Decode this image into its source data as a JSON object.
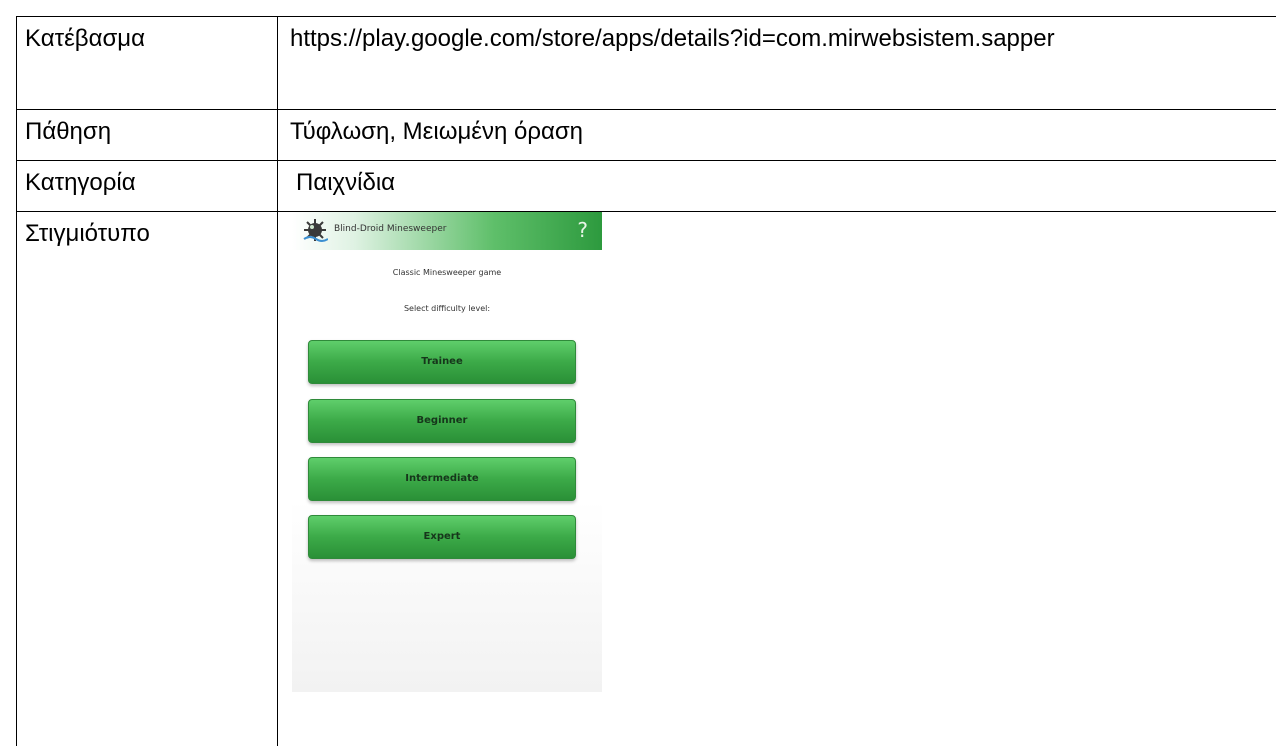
{
  "rows": {
    "download": {
      "label": "Κατέβασμα",
      "value": "https://play.google.com/store/apps/details?id=com.mirwebsistem.sapper"
    },
    "condition": {
      "label": "Πάθηση",
      "value": "Τύφλωση, Μειωμένη όραση"
    },
    "category": {
      "label": "Κατηγορία",
      "value": "Παιχνίδια"
    },
    "screenshot": {
      "label": "Στιγμιότυπο"
    }
  },
  "app": {
    "title": "Blind-Droid Minesweeper",
    "help": "?",
    "subtitle": "Classic Minesweeper game",
    "select_label": "Select difficulty level:",
    "levels": [
      "Trainee",
      "Beginner",
      "Intermediate",
      "Expert"
    ],
    "colors": {
      "accent": "#3caa48",
      "accent_dark": "#2a9037"
    }
  }
}
